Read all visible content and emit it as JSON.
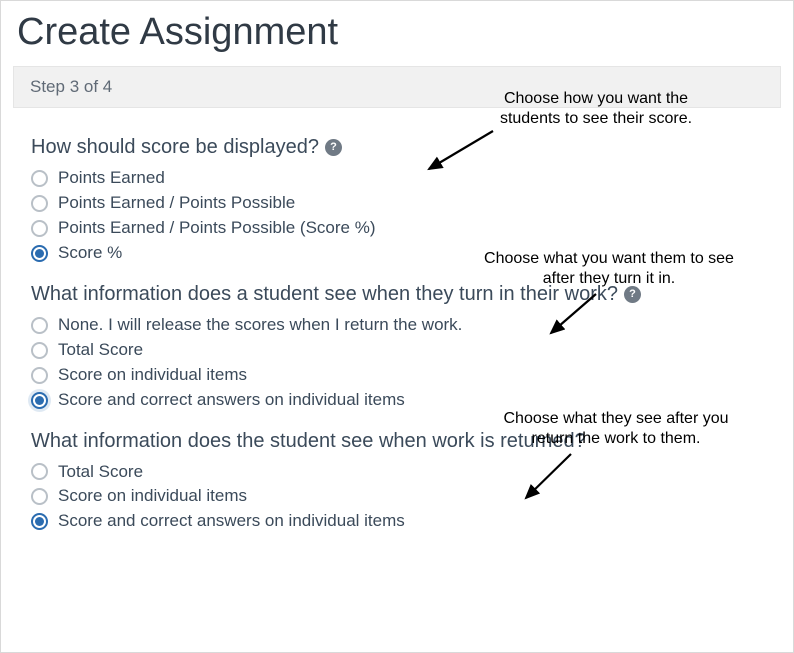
{
  "page": {
    "title": "Create Assignment",
    "step_label": "Step 3 of 4"
  },
  "q1": {
    "heading": "How should score be displayed?",
    "has_help": true,
    "selected_index": 3,
    "options": [
      "Points Earned",
      "Points Earned / Points Possible",
      "Points Earned / Points Possible (Score %)",
      "Score %"
    ]
  },
  "q2": {
    "heading": "What information does a student see when they turn in their work?",
    "has_help": true,
    "selected_index": 3,
    "options": [
      "None. I will release the scores when I return the work.",
      "Total Score",
      "Score on individual items",
      "Score and correct answers on individual items"
    ]
  },
  "q3": {
    "heading": "What information does the student see when work is returned?",
    "has_help": false,
    "selected_index": 2,
    "options": [
      "Total Score",
      "Score on individual items",
      "Score and correct answers on individual items"
    ]
  },
  "annotations": {
    "a1": "Choose how you want the students to see their score.",
    "a2": "Choose what you want them to see after they turn it in.",
    "a3": "Choose what they see after you return the work to them."
  }
}
